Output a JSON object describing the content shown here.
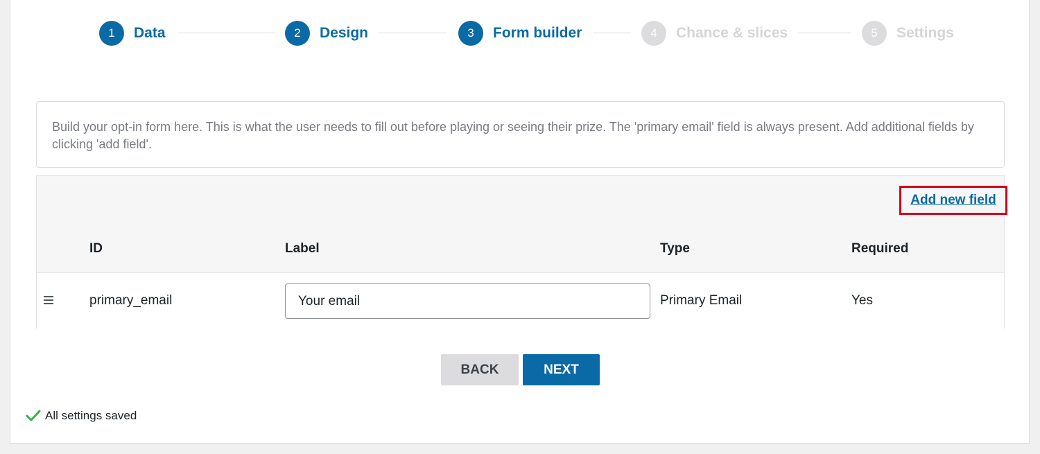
{
  "steps": [
    {
      "number": "1",
      "label": "Data",
      "state": "complete"
    },
    {
      "number": "2",
      "label": "Design",
      "state": "complete"
    },
    {
      "number": "3",
      "label": "Form builder",
      "state": "active"
    },
    {
      "number": "4",
      "label": "Chance & slices",
      "state": "inactive"
    },
    {
      "number": "5",
      "label": "Settings",
      "state": "inactive"
    }
  ],
  "info_text": "Build your opt-in form here. This is what the user needs to fill out before playing or seeing their prize. The 'primary email' field is always present. Add additional fields by clicking 'add field'.",
  "toolbar": {
    "add_field_label": "Add new field"
  },
  "table": {
    "columns": {
      "id": "ID",
      "label": "Label",
      "type": "Type",
      "required": "Required"
    },
    "rows": [
      {
        "id": "primary_email",
        "label_value": "Your email",
        "type": "Primary Email",
        "required": "Yes"
      }
    ]
  },
  "buttons": {
    "back": "BACK",
    "next": "NEXT"
  },
  "status": {
    "saved_text": "All settings saved"
  },
  "colors": {
    "accent": "#0a6aa5",
    "highlight": "#d0021b",
    "success": "#2fb344"
  }
}
